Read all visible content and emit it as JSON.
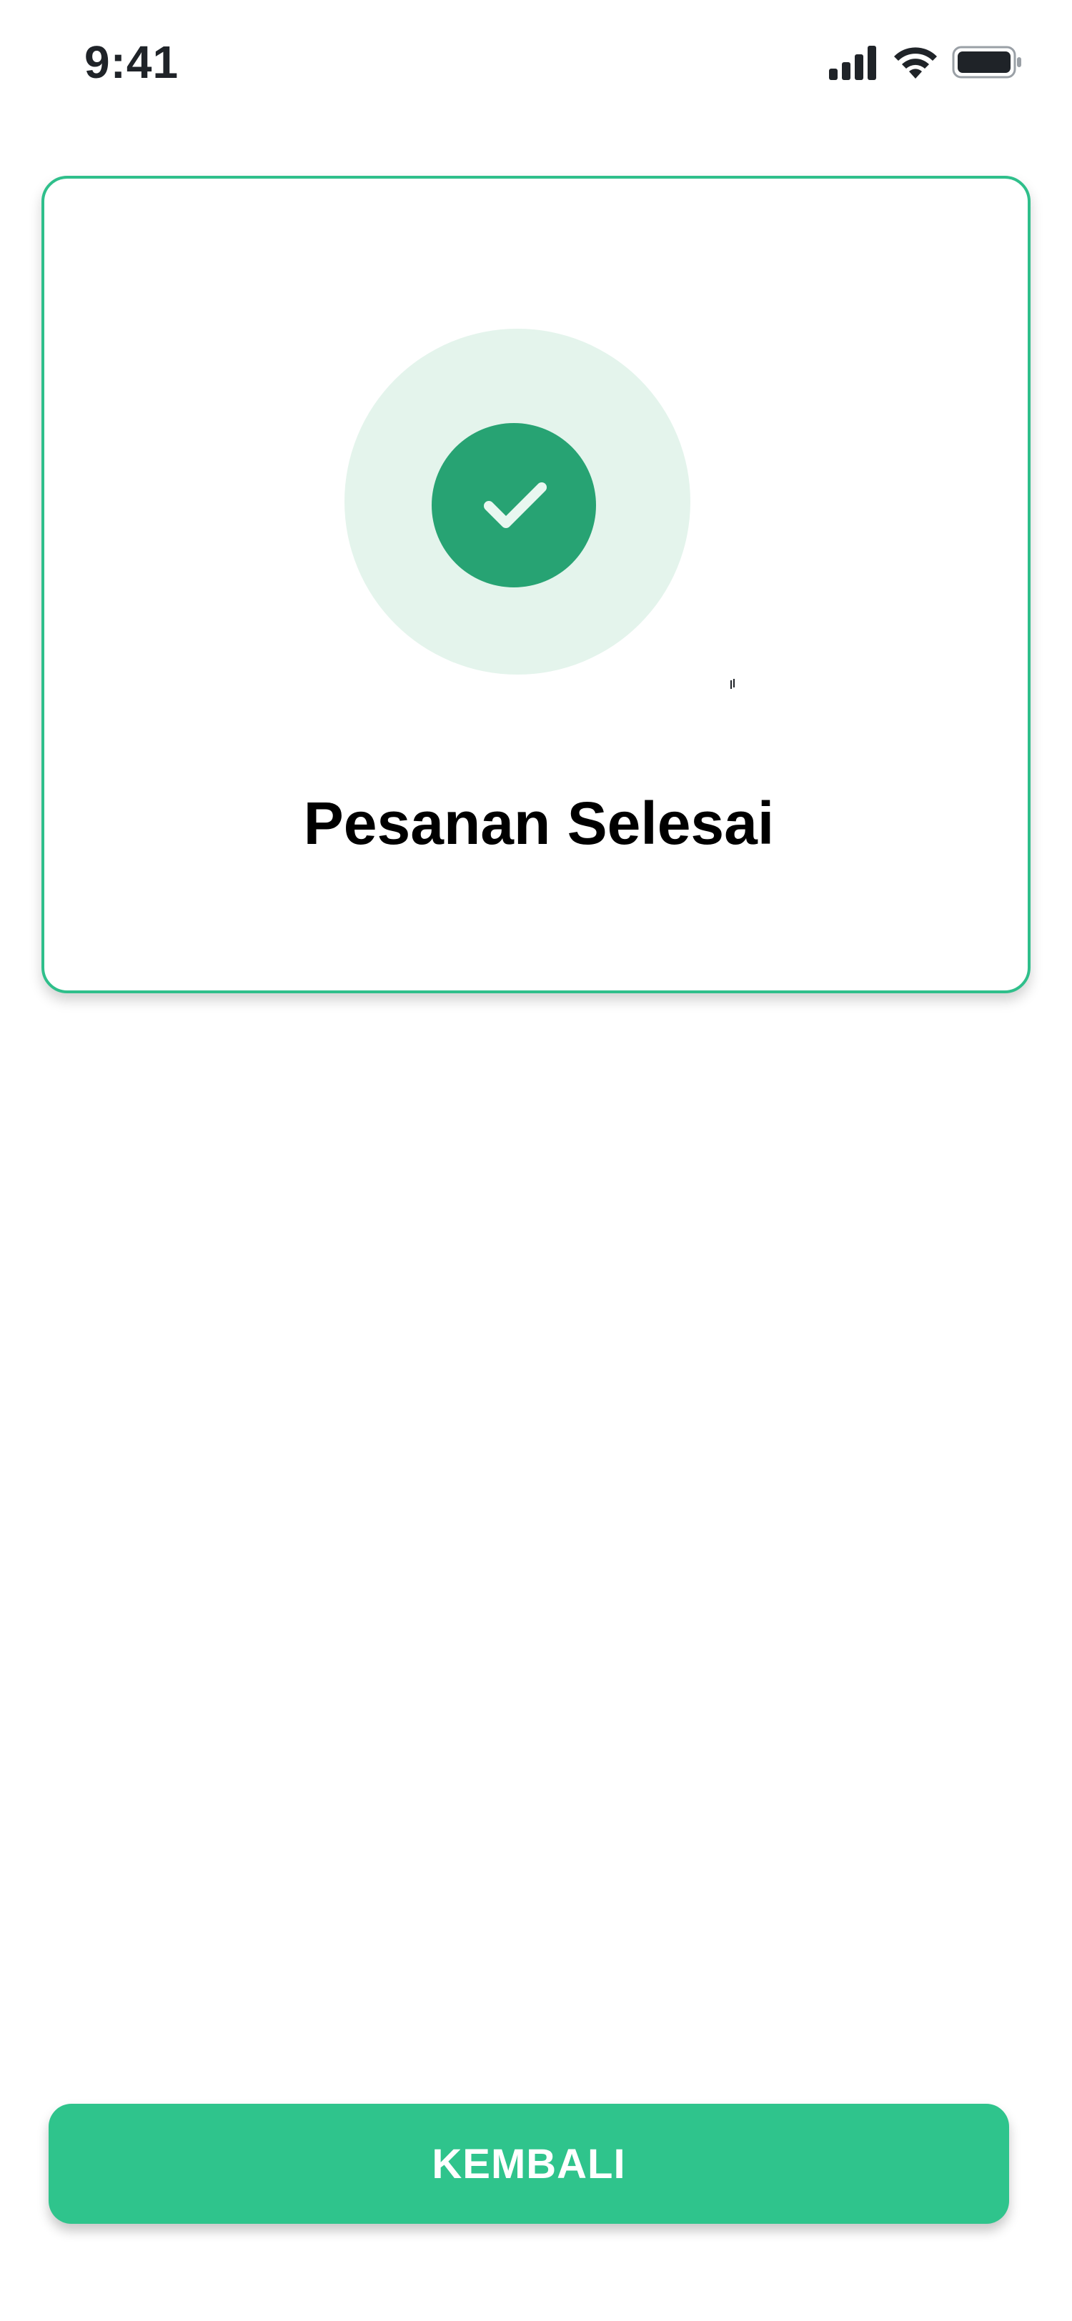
{
  "status_bar": {
    "time": "9:41",
    "icons": [
      "cellular-signal-icon",
      "wifi-icon",
      "battery-icon"
    ]
  },
  "card": {
    "icon": "checkmark-icon",
    "title": "Pesanan Selesai"
  },
  "actions": {
    "back_label": "KEMBALI"
  },
  "colors": {
    "accent": "#2fc48c",
    "card_border": "#2fbf8b",
    "check_circle": "#27a373",
    "check_halo": "#e4f4ec",
    "text": "#000000",
    "status_text": "#1f2328"
  }
}
